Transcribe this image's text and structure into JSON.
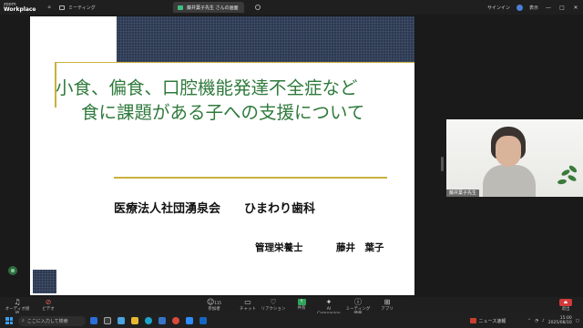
{
  "topbar": {
    "brand_line1": "zoom",
    "brand_line2": "Workplace",
    "tab_meeting": "ミーティング",
    "tab_share": "藤井葉子先生 さんの画面",
    "signin": "サインイン",
    "view_label": "表示",
    "minimize": "—",
    "maximize": "□",
    "close": "✕"
  },
  "slide": {
    "title_line1": "小食、偏食、口腔機能発達不全症など",
    "title_line2": "食に課題がある子への支援について",
    "organization": "医療法人社団湧泉会　　ひまわり歯科",
    "role": "管理栄養士",
    "presenter": "藤井　葉子",
    "colors": {
      "title": "#2f7a3c",
      "accent_gold": "#c9b13c",
      "band_navy": "#2d3a52"
    }
  },
  "participant": {
    "name": "藤井葉子先生"
  },
  "toolbar": {
    "audio": "オーディオ接続",
    "video": "ビデオ",
    "participants": "参加者",
    "participants_count": "115",
    "chat": "チャット",
    "react": "リアクション",
    "share": "共有",
    "ai": "AI Companion",
    "info": "ミーティング情報",
    "apps": "アプリ",
    "leave": "退出"
  },
  "taskbar": {
    "search_placeholder": "ここに入力して検索",
    "news": "ニュース速報",
    "time": "15:00",
    "date": "2025/08/10"
  }
}
